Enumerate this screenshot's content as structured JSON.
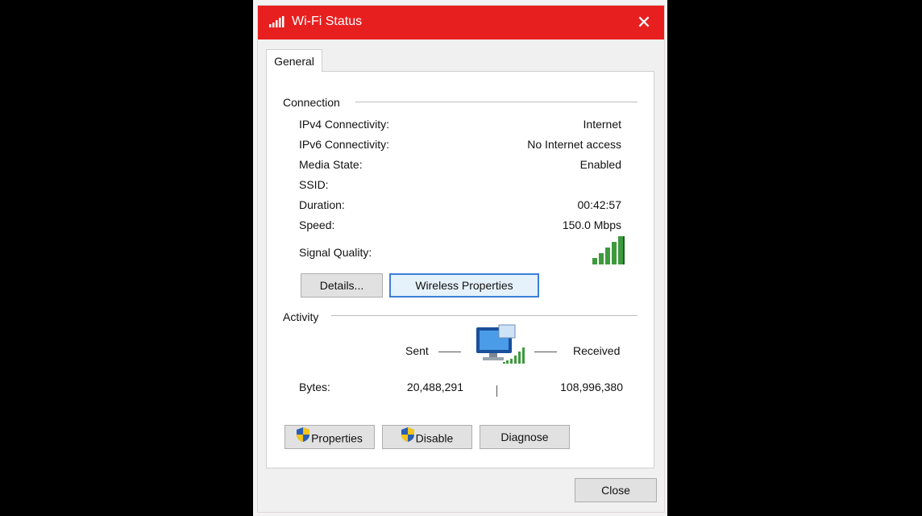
{
  "window": {
    "title": "Wi-Fi Status",
    "close_glyph": "✕",
    "title_icon": "wifi-signal-icon",
    "accent_color": "#e81f1f"
  },
  "tabs": [
    {
      "label": "General",
      "active": true
    }
  ],
  "connection": {
    "heading": "Connection",
    "rows": [
      {
        "label": "IPv4 Connectivity:",
        "value": "Internet"
      },
      {
        "label": "IPv6 Connectivity:",
        "value": "No Internet access"
      },
      {
        "label": "Media State:",
        "value": "Enabled"
      },
      {
        "label": "SSID:",
        "value": ""
      },
      {
        "label": "Duration:",
        "value": "00:42:57"
      },
      {
        "label": "Speed:",
        "value": "150.0 Mbps"
      }
    ],
    "signal_label": "Signal Quality:",
    "signal_icon": "signal-bars-icon",
    "signal_bars_filled": 5,
    "signal_bars_total": 5,
    "details_button": "Details...",
    "wireless_properties_button": "Wireless Properties"
  },
  "activity": {
    "heading": "Activity",
    "sent_label": "Sent",
    "received_label": "Received",
    "bytes_label": "Bytes:",
    "bytes_sent": "20,488,291",
    "bytes_received": "108,996,380",
    "network_icon": "network-computer-icon"
  },
  "buttons": {
    "properties": "Properties",
    "disable": "Disable",
    "diagnose": "Diagnose",
    "close": "Close",
    "shield_icon": "uac-shield-icon"
  }
}
